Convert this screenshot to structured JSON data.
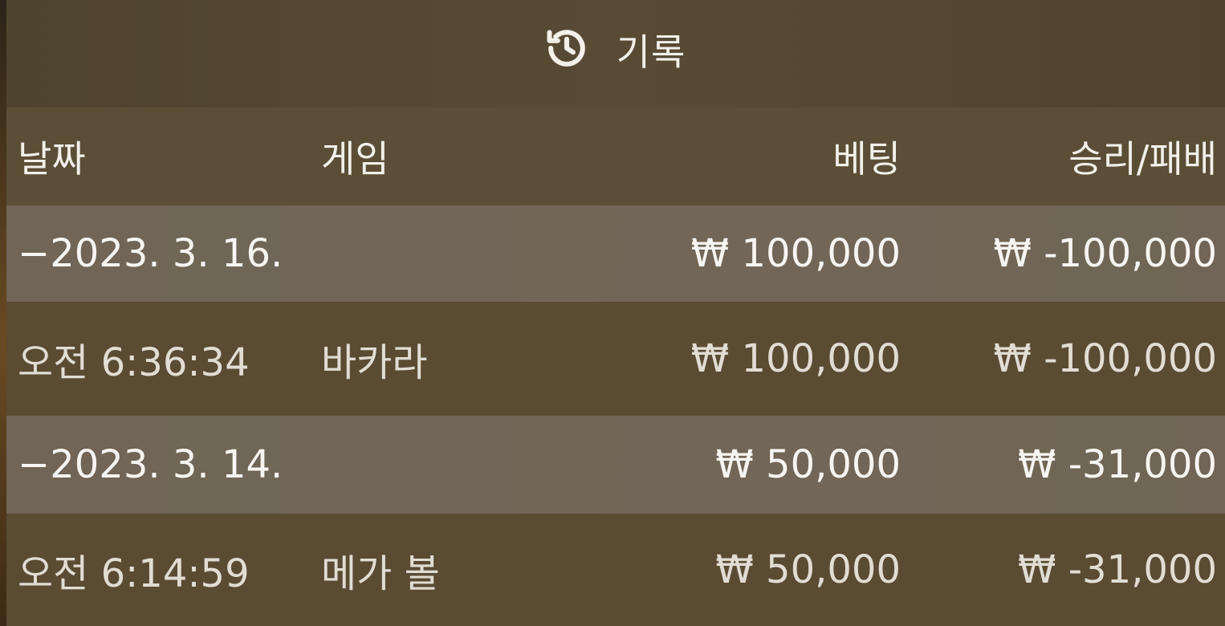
{
  "title": {
    "icon": "history-icon",
    "label": "기록"
  },
  "columns": {
    "date": "날짜",
    "game": "게임",
    "bet": "베팅",
    "result": "승리/패배"
  },
  "rows": [
    {
      "kind": "date",
      "date": "−2023. 3. 16.",
      "game": "",
      "bet": "₩ 100,000",
      "result": "₩ -100,000"
    },
    {
      "kind": "detail",
      "date": "오전 6:36:34",
      "game": "바카라",
      "bet": "₩ 100,000",
      "result": "₩ -100,000"
    },
    {
      "kind": "date",
      "date": "−2023. 3. 14.",
      "game": "",
      "bet": "₩ 50,000",
      "result": "₩ -31,000"
    },
    {
      "kind": "detail",
      "date": "오전 6:14:59",
      "game": "메가 볼",
      "bet": "₩ 50,000",
      "result": "₩ -31,000"
    }
  ]
}
